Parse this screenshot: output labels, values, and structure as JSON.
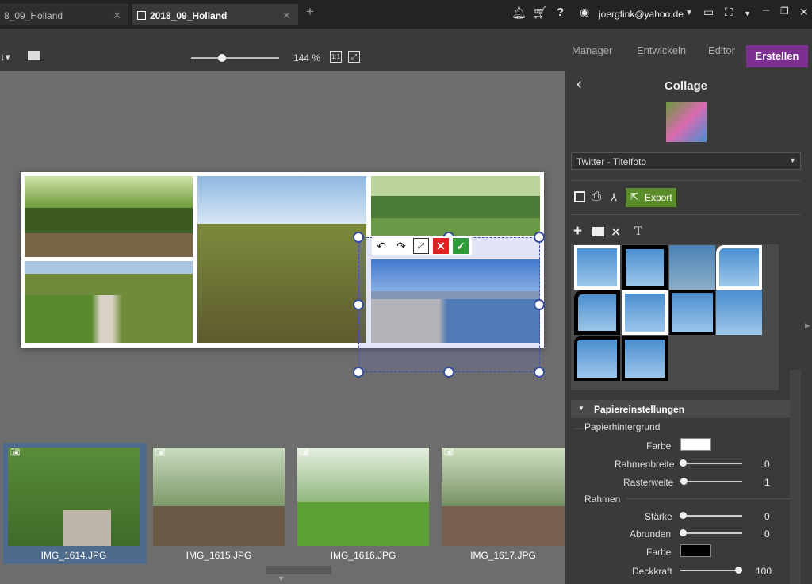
{
  "tabs": [
    {
      "label": "8_09_Holland"
    },
    {
      "label": "2018_09_Holland"
    }
  ],
  "account": {
    "email": "joergfink@yahoo.de"
  },
  "toolbar": {
    "zoom": "144 %",
    "zoom_level": 0.3
  },
  "modules": {
    "manager": "Manager",
    "develop": "Entwickeln",
    "editor": "Editor",
    "create": "Erstellen"
  },
  "panel": {
    "title": "Collage",
    "preset": "Twitter - Titelfoto",
    "export": "Export",
    "paper_section": "Papiereinstellungen",
    "paper_bg": "Papierhintergrund",
    "color_label": "Farbe",
    "frame_width_label": "Rahmenbreite",
    "frame_width_value": "0",
    "grid_label": "Rasterweite",
    "grid_value": "1",
    "frame_section": "Rahmen",
    "strength_label": "Stärke",
    "strength_value": "0",
    "round_label": "Abrunden",
    "round_value": "0",
    "frame_color_label": "Farbe",
    "opacity_label": "Deckkraft",
    "opacity_value": "100",
    "paper_color": "#ffffff",
    "frame_color": "#000000"
  },
  "filmstrip": [
    {
      "name": "IMG_1614.JPG"
    },
    {
      "name": "IMG_1615.JPG"
    },
    {
      "name": "IMG_1616.JPG"
    },
    {
      "name": "IMG_1617.JPG"
    }
  ],
  "colors": {
    "accent": "#7b2f8e",
    "export_green": "#5b8c2a",
    "selection": "#3a4fb0"
  }
}
